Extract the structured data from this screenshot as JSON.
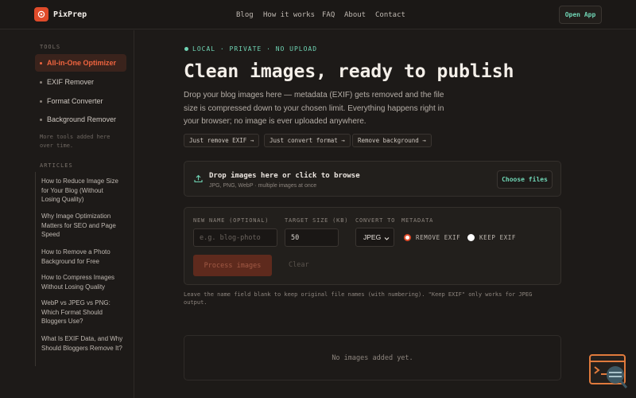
{
  "brand": {
    "name": "PixPrep"
  },
  "nav": [
    {
      "label": "Blog"
    },
    {
      "label": "How it works"
    },
    {
      "label": "FAQ"
    },
    {
      "label": "About"
    },
    {
      "label": "Contact"
    }
  ],
  "header": {
    "cta_label": "Open App"
  },
  "sidebar": {
    "tools_heading": "TOOLS",
    "tools": [
      {
        "label": "All-in-One Optimizer",
        "active": true
      },
      {
        "label": "EXIF Remover",
        "active": false
      },
      {
        "label": "Format Converter",
        "active": false
      },
      {
        "label": "Background Remover",
        "active": false
      }
    ],
    "more_note": "More tools added here over time.",
    "articles_heading": "ARTICLES",
    "articles": [
      {
        "title": "How to Reduce Image Size for Your Blog (Without Losing Quality)"
      },
      {
        "title": "Why Image Optimization Matters for SEO and Page Speed"
      },
      {
        "title": "How to Remove a Photo Background for Free"
      },
      {
        "title": "How to Compress Images Without Losing Quality"
      },
      {
        "title": "WebP vs JPEG vs PNG: Which Format Should Bloggers Use?"
      },
      {
        "title": "What Is EXIF Data, and Why Should Bloggers Remove It?"
      }
    ]
  },
  "hero": {
    "tagline": "LOCAL · PRIVATE · NO UPLOAD",
    "title": "Clean images, ready to publish",
    "description": "Drop your blog images here — metadata (EXIF) gets removed and the file size is compressed down to your chosen limit. Everything happens right in your browser; no image is ever uploaded anywhere.",
    "chips": [
      {
        "label": "Just remove EXIF →"
      },
      {
        "label": "Just convert format →"
      },
      {
        "label": "Remove background →"
      }
    ]
  },
  "dropzone": {
    "title": "Drop images here or click to browse",
    "subtitle": "JPG, PNG, WebP · multiple images at once",
    "button_label": "Choose files"
  },
  "form": {
    "name_label": "NEW NAME (OPTIONAL)",
    "name_placeholder": "e.g. blog-photo",
    "size_label": "TARGET SIZE (KB)",
    "size_value": "50",
    "convert_label": "CONVERT TO",
    "convert_value": "JPEG",
    "metadata_label": "METADATA",
    "remove_exif_label": "REMOVE EXIF",
    "keep_exif_label": "KEEP EXIF",
    "process_label": "Process images",
    "clear_label": "Clear"
  },
  "hint": "Leave the name field blank to keep original file names (with numbering). \"Keep EXIF\" only works for JPEG output.",
  "empty_state": "No images added yet.",
  "colors": {
    "accent": "#e04b2a",
    "teal": "#6fd4b4",
    "background": "#1d1a18"
  }
}
